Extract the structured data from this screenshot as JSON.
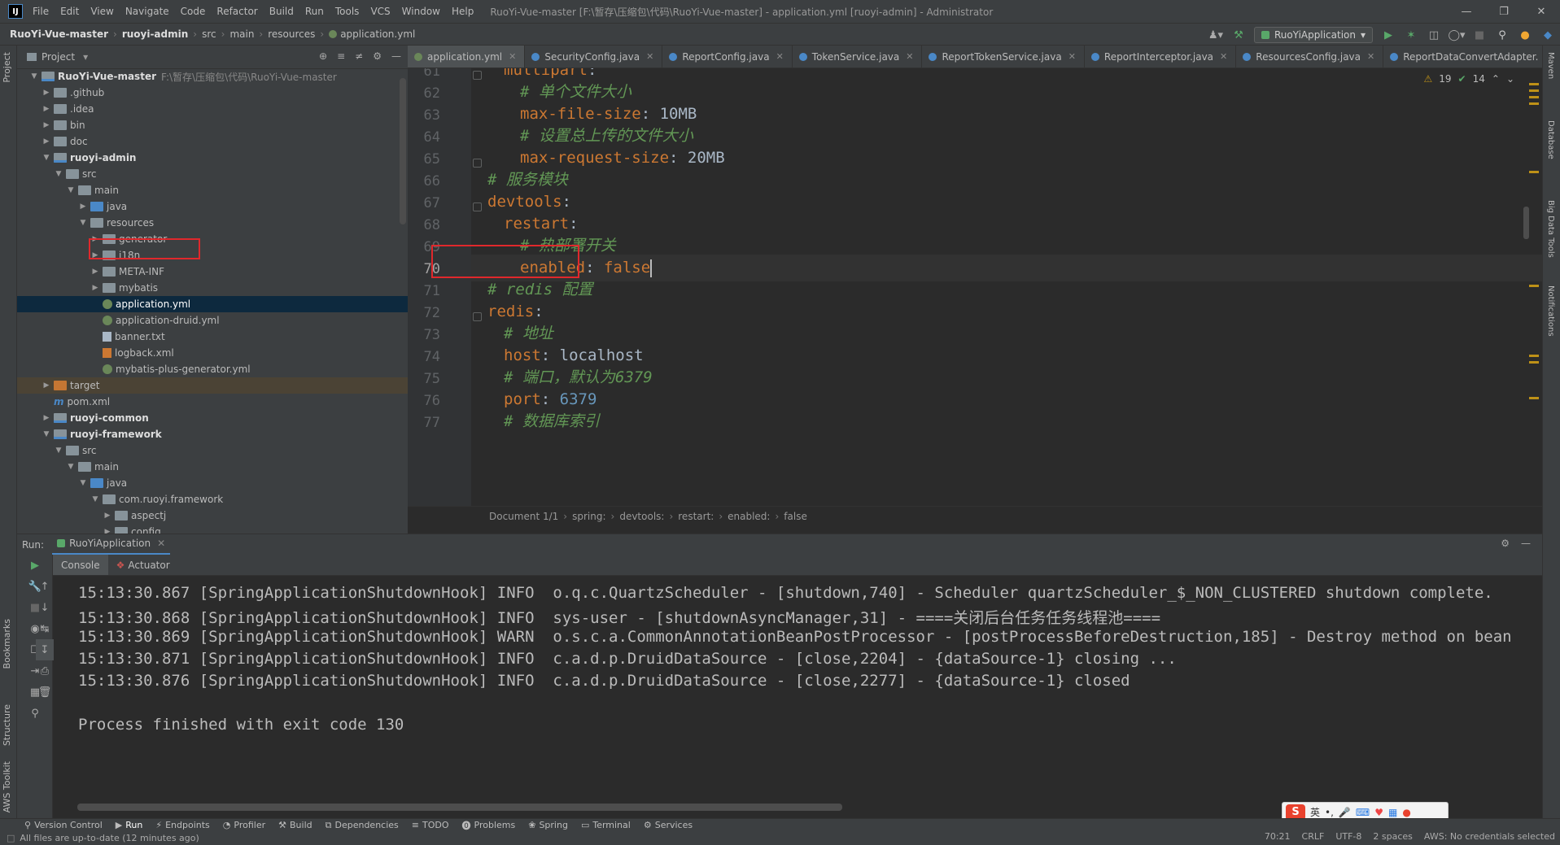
{
  "titlebar": {
    "logo": "IJ",
    "menu": [
      "File",
      "Edit",
      "View",
      "Navigate",
      "Code",
      "Refactor",
      "Build",
      "Run",
      "Tools",
      "VCS",
      "Window",
      "Help"
    ],
    "title": "RuoYi-Vue-master [F:\\暂存\\压缩包\\代码\\RuoYi-Vue-master] - application.yml [ruoyi-admin] - Administrator"
  },
  "navbar": {
    "crumbs": [
      "RuoYi-Vue-master",
      "ruoyi-admin",
      "src",
      "main",
      "resources",
      "application.yml"
    ],
    "run_config": "RuoYiApplication"
  },
  "left_strip": {
    "project": "Project",
    "bookmarks": "Bookmarks",
    "structure": "Structure",
    "aws": "AWS Toolkit"
  },
  "right_strip": {
    "maven": "Maven",
    "database": "Database",
    "bigdata": "Big Data Tools",
    "notifications": "Notifications"
  },
  "project_panel": {
    "title": "Project",
    "tree": [
      {
        "label": "RuoYi-Vue-master",
        "path": "F:\\暂存\\压缩包\\代码\\RuoYi-Vue-master",
        "bold": true
      },
      {
        "label": ".github"
      },
      {
        "label": ".idea"
      },
      {
        "label": "bin"
      },
      {
        "label": "doc"
      },
      {
        "label": "ruoyi-admin",
        "bold": true
      },
      {
        "label": "src"
      },
      {
        "label": "main"
      },
      {
        "label": "java"
      },
      {
        "label": "resources"
      },
      {
        "label": "generator"
      },
      {
        "label": "i18n"
      },
      {
        "label": "META-INF"
      },
      {
        "label": "mybatis"
      },
      {
        "label": "application.yml"
      },
      {
        "label": "application-druid.yml"
      },
      {
        "label": "banner.txt"
      },
      {
        "label": "logback.xml"
      },
      {
        "label": "mybatis-plus-generator.yml"
      },
      {
        "label": "target"
      },
      {
        "label": "pom.xml"
      },
      {
        "label": "ruoyi-common",
        "bold": true
      },
      {
        "label": "ruoyi-framework",
        "bold": true
      },
      {
        "label": "src"
      },
      {
        "label": "main"
      },
      {
        "label": "java"
      },
      {
        "label": "com.ruoyi.framework"
      },
      {
        "label": "aspectj"
      },
      {
        "label": "config"
      }
    ]
  },
  "tabs": [
    {
      "label": "application.yml",
      "active": true,
      "color": "#6a8759"
    },
    {
      "label": "SecurityConfig.java",
      "color": "#4a88c7"
    },
    {
      "label": "ReportConfig.java",
      "color": "#4a88c7"
    },
    {
      "label": "TokenService.java",
      "color": "#4a88c7"
    },
    {
      "label": "ReportTokenService.java",
      "color": "#4a88c7"
    },
    {
      "label": "ReportInterceptor.java",
      "color": "#4a88c7"
    },
    {
      "label": "ResourcesConfig.java",
      "color": "#4a88c7"
    },
    {
      "label": "ReportDataConvertAdapter.",
      "color": "#4a88c7"
    }
  ],
  "inspections": {
    "warnings": "19",
    "ok": "14"
  },
  "editor": {
    "lines": [
      {
        "n": "61",
        "indent": 1,
        "key": "multipart",
        "sep": ":",
        "val": "",
        "type": "kv"
      },
      {
        "n": "62",
        "indent": 2,
        "comment": "# 单个文件大小",
        "type": "c"
      },
      {
        "n": "63",
        "indent": 2,
        "key": "max-file-size",
        "sep": ": ",
        "val": "10MB",
        "type": "kv"
      },
      {
        "n": "64",
        "indent": 2,
        "comment": "# 设置总上传的文件大小",
        "type": "c"
      },
      {
        "n": "65",
        "indent": 2,
        "key": "max-request-size",
        "sep": ": ",
        "val": "20MB",
        "type": "kv"
      },
      {
        "n": "66",
        "indent": 0,
        "comment": "# 服务模块",
        "type": "c"
      },
      {
        "n": "67",
        "indent": 0,
        "key": "devtools",
        "sep": ":",
        "val": "",
        "type": "kv"
      },
      {
        "n": "68",
        "indent": 1,
        "key": "restart",
        "sep": ":",
        "val": "",
        "type": "kv"
      },
      {
        "n": "69",
        "indent": 2,
        "comment": "# 热部署开关",
        "type": "c"
      },
      {
        "n": "70",
        "indent": 2,
        "key": "enabled",
        "sep": ": ",
        "val": "false",
        "type": "kv",
        "valcls": "key",
        "current": true
      },
      {
        "n": "71",
        "indent": 0,
        "comment": "# redis 配置",
        "type": "c"
      },
      {
        "n": "72",
        "indent": 0,
        "key": "redis",
        "sep": ":",
        "val": "",
        "type": "kv"
      },
      {
        "n": "73",
        "indent": 1,
        "comment": "# 地址",
        "type": "c"
      },
      {
        "n": "74",
        "indent": 1,
        "key": "host",
        "sep": ": ",
        "val": "localhost",
        "type": "kv"
      },
      {
        "n": "75",
        "indent": 1,
        "comment": "# 端口，默认为6379",
        "type": "c"
      },
      {
        "n": "76",
        "indent": 1,
        "key": "port",
        "sep": ": ",
        "val": "6379",
        "type": "kv",
        "valcls": "num"
      },
      {
        "n": "77",
        "indent": 1,
        "comment": "# 数据库索引",
        "type": "c"
      }
    ]
  },
  "editor_breadcrumb": [
    "Document 1/1",
    "spring:",
    "devtools:",
    "restart:",
    "enabled:",
    "false"
  ],
  "run_panel": {
    "label": "Run:",
    "config": "RuoYiApplication",
    "tabs": [
      "Console",
      "Actuator"
    ],
    "lines": [
      "15:13:30.867 [SpringApplicationShutdownHook] INFO  o.q.c.QuartzScheduler - [shutdown,740] - Scheduler quartzScheduler_$_NON_CLUSTERED shutdown complete.",
      "15:13:30.868 [SpringApplicationShutdownHook] INFO  sys-user - [shutdownAsyncManager,31] - ====关闭后台任务任务线程池====",
      "15:13:30.869 [SpringApplicationShutdownHook] WARN  o.s.c.a.CommonAnnotationBeanPostProcessor - [postProcessBeforeDestruction,185] - Destroy method on bean",
      "15:13:30.871 [SpringApplicationShutdownHook] INFO  c.a.d.p.DruidDataSource - [close,2204] - {dataSource-1} closing ...",
      "15:13:30.876 [SpringApplicationShutdownHook] INFO  c.a.d.p.DruidDataSource - [close,2277] - {dataSource-1} closed",
      "",
      "Process finished with exit code 130"
    ]
  },
  "bottom_tools": [
    "Version Control",
    "Run",
    "Endpoints",
    "Profiler",
    "Build",
    "Dependencies",
    "TODO",
    "Problems",
    "Spring",
    "Terminal",
    "Services"
  ],
  "status": {
    "left": "All files are up-to-date (12 minutes ago)",
    "position": "70:21",
    "line_sep": "CRLF",
    "encoding": "UTF-8",
    "indent": "2 spaces",
    "aws": "AWS: No credentials selected"
  },
  "ime": {
    "logo": "S",
    "lang": "英"
  }
}
